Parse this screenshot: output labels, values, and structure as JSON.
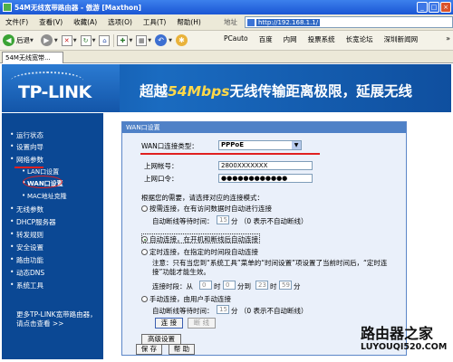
{
  "window": {
    "title": "54M无线宽带路由器 - 傲游 [Maxthon]",
    "controls": [
      "_",
      "□",
      "×"
    ]
  },
  "menubar": {
    "items": [
      "文件(F)",
      "查看(V)",
      "收藏(A)",
      "选项(O)",
      "工具(T)",
      "帮助(H)"
    ],
    "address_label": "地址",
    "address_value": "http://192.168.1.1/"
  },
  "toolbar": {
    "back_label": "后退",
    "links": [
      "PCauto",
      "百度",
      "内网",
      "投票系统",
      "长宽论坛",
      "深圳新闻网"
    ],
    "more": "»"
  },
  "tab": {
    "label": "54M无线宽带..."
  },
  "banner": {
    "logo": "TP-LINK",
    "slogan_prefix": "超越",
    "slogan_speed": "54Mbps",
    "slogan_rest": "无线传输距离极限，延展无线"
  },
  "sidebar": {
    "items": [
      "运行状态",
      "设置向导",
      "网络参数",
      "无线参数",
      "DHCP服务器",
      "转发规则",
      "安全设置",
      "路由功能",
      "动态DNS",
      "系统工具"
    ],
    "sub_items": [
      "LAN口设置",
      "WAN口设置",
      "MAC地址克隆"
    ],
    "footer": "更多TP-LINK宽带路由器，请点击查看 >>"
  },
  "panel": {
    "title": "WAN口设置",
    "conn_type_label": "WAN口连接类型：",
    "conn_type_value": "PPPoE",
    "account_label": "上网帐号：",
    "account_value": "2800XXXXXXX",
    "password_label": "上网口令：",
    "password_value": "●●●●●●●●●●●●",
    "choose_label": "根据您的需要，请选择对应的连接模式：",
    "mode1_label": "按需连接，在有访问数据时自动进行连接",
    "idle_label": "自动断线等待时间：",
    "idle_value": "15",
    "idle_unit": "分 （0 表示不自动断线）",
    "mode2_label": "自动连接，在开机和断线后自动连接",
    "mode3_label": "定时连接，在指定的时间段自动连接",
    "note": "注意：只有当您到“系统工具”菜单的“时间设置”项设置了当前时间后，“定时连接”功能才能生效。",
    "period_label": "连接时段：从",
    "from_hour": "0",
    "hour_label": "时",
    "from_min": "0",
    "to_label": "分到",
    "to_hour": "23",
    "to_min": "59",
    "min_label": "分",
    "mode4_label": "手动连接，由用户手动连接",
    "idle2_value": "15",
    "connect_btn": "连 接",
    "disconnect_btn": "断 线",
    "advanced_btn": "高级设置",
    "save_btn": "保 存",
    "help_btn": "帮 助"
  },
  "watermark": {
    "cn": "路由器之家",
    "url": "LUYOUQI520.COM"
  }
}
